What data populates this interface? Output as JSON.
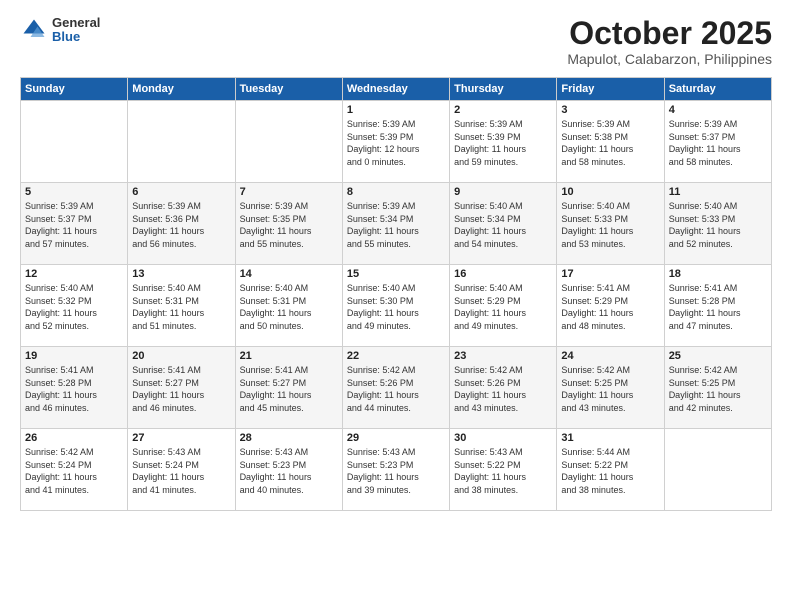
{
  "header": {
    "logo_general": "General",
    "logo_blue": "Blue",
    "month_title": "October 2025",
    "location": "Mapulot, Calabarzon, Philippines"
  },
  "calendar": {
    "weekdays": [
      "Sunday",
      "Monday",
      "Tuesday",
      "Wednesday",
      "Thursday",
      "Friday",
      "Saturday"
    ],
    "weeks": [
      [
        {
          "day": "",
          "info": ""
        },
        {
          "day": "",
          "info": ""
        },
        {
          "day": "",
          "info": ""
        },
        {
          "day": "1",
          "info": "Sunrise: 5:39 AM\nSunset: 5:39 PM\nDaylight: 12 hours\nand 0 minutes."
        },
        {
          "day": "2",
          "info": "Sunrise: 5:39 AM\nSunset: 5:39 PM\nDaylight: 11 hours\nand 59 minutes."
        },
        {
          "day": "3",
          "info": "Sunrise: 5:39 AM\nSunset: 5:38 PM\nDaylight: 11 hours\nand 58 minutes."
        },
        {
          "day": "4",
          "info": "Sunrise: 5:39 AM\nSunset: 5:37 PM\nDaylight: 11 hours\nand 58 minutes."
        }
      ],
      [
        {
          "day": "5",
          "info": "Sunrise: 5:39 AM\nSunset: 5:37 PM\nDaylight: 11 hours\nand 57 minutes."
        },
        {
          "day": "6",
          "info": "Sunrise: 5:39 AM\nSunset: 5:36 PM\nDaylight: 11 hours\nand 56 minutes."
        },
        {
          "day": "7",
          "info": "Sunrise: 5:39 AM\nSunset: 5:35 PM\nDaylight: 11 hours\nand 55 minutes."
        },
        {
          "day": "8",
          "info": "Sunrise: 5:39 AM\nSunset: 5:34 PM\nDaylight: 11 hours\nand 55 minutes."
        },
        {
          "day": "9",
          "info": "Sunrise: 5:40 AM\nSunset: 5:34 PM\nDaylight: 11 hours\nand 54 minutes."
        },
        {
          "day": "10",
          "info": "Sunrise: 5:40 AM\nSunset: 5:33 PM\nDaylight: 11 hours\nand 53 minutes."
        },
        {
          "day": "11",
          "info": "Sunrise: 5:40 AM\nSunset: 5:33 PM\nDaylight: 11 hours\nand 52 minutes."
        }
      ],
      [
        {
          "day": "12",
          "info": "Sunrise: 5:40 AM\nSunset: 5:32 PM\nDaylight: 11 hours\nand 52 minutes."
        },
        {
          "day": "13",
          "info": "Sunrise: 5:40 AM\nSunset: 5:31 PM\nDaylight: 11 hours\nand 51 minutes."
        },
        {
          "day": "14",
          "info": "Sunrise: 5:40 AM\nSunset: 5:31 PM\nDaylight: 11 hours\nand 50 minutes."
        },
        {
          "day": "15",
          "info": "Sunrise: 5:40 AM\nSunset: 5:30 PM\nDaylight: 11 hours\nand 49 minutes."
        },
        {
          "day": "16",
          "info": "Sunrise: 5:40 AM\nSunset: 5:29 PM\nDaylight: 11 hours\nand 49 minutes."
        },
        {
          "day": "17",
          "info": "Sunrise: 5:41 AM\nSunset: 5:29 PM\nDaylight: 11 hours\nand 48 minutes."
        },
        {
          "day": "18",
          "info": "Sunrise: 5:41 AM\nSunset: 5:28 PM\nDaylight: 11 hours\nand 47 minutes."
        }
      ],
      [
        {
          "day": "19",
          "info": "Sunrise: 5:41 AM\nSunset: 5:28 PM\nDaylight: 11 hours\nand 46 minutes."
        },
        {
          "day": "20",
          "info": "Sunrise: 5:41 AM\nSunset: 5:27 PM\nDaylight: 11 hours\nand 46 minutes."
        },
        {
          "day": "21",
          "info": "Sunrise: 5:41 AM\nSunset: 5:27 PM\nDaylight: 11 hours\nand 45 minutes."
        },
        {
          "day": "22",
          "info": "Sunrise: 5:42 AM\nSunset: 5:26 PM\nDaylight: 11 hours\nand 44 minutes."
        },
        {
          "day": "23",
          "info": "Sunrise: 5:42 AM\nSunset: 5:26 PM\nDaylight: 11 hours\nand 43 minutes."
        },
        {
          "day": "24",
          "info": "Sunrise: 5:42 AM\nSunset: 5:25 PM\nDaylight: 11 hours\nand 43 minutes."
        },
        {
          "day": "25",
          "info": "Sunrise: 5:42 AM\nSunset: 5:25 PM\nDaylight: 11 hours\nand 42 minutes."
        }
      ],
      [
        {
          "day": "26",
          "info": "Sunrise: 5:42 AM\nSunset: 5:24 PM\nDaylight: 11 hours\nand 41 minutes."
        },
        {
          "day": "27",
          "info": "Sunrise: 5:43 AM\nSunset: 5:24 PM\nDaylight: 11 hours\nand 41 minutes."
        },
        {
          "day": "28",
          "info": "Sunrise: 5:43 AM\nSunset: 5:23 PM\nDaylight: 11 hours\nand 40 minutes."
        },
        {
          "day": "29",
          "info": "Sunrise: 5:43 AM\nSunset: 5:23 PM\nDaylight: 11 hours\nand 39 minutes."
        },
        {
          "day": "30",
          "info": "Sunrise: 5:43 AM\nSunset: 5:22 PM\nDaylight: 11 hours\nand 38 minutes."
        },
        {
          "day": "31",
          "info": "Sunrise: 5:44 AM\nSunset: 5:22 PM\nDaylight: 11 hours\nand 38 minutes."
        },
        {
          "day": "",
          "info": ""
        }
      ]
    ]
  }
}
